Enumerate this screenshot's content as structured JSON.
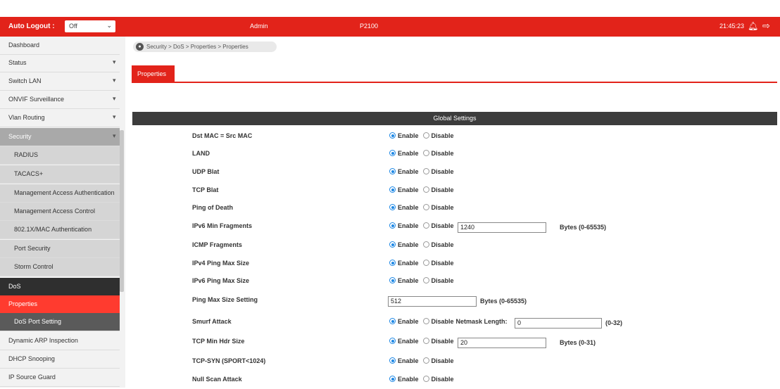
{
  "header": {
    "auto_logout_label": "Auto Logout :",
    "auto_logout_value": "Off",
    "user": "Admin",
    "model": "P2100",
    "time": "21:45:23"
  },
  "sidebar": {
    "items": [
      {
        "label": "Dashboard",
        "arrow": ""
      },
      {
        "label": "Status",
        "arrow": "▾"
      },
      {
        "label": "Switch LAN",
        "arrow": "▾"
      },
      {
        "label": "ONVIF Surveillance",
        "arrow": "▾"
      },
      {
        "label": "Vlan Routing",
        "arrow": "▾"
      },
      {
        "label": "Security",
        "arrow": "▾"
      },
      {
        "label": "RADIUS",
        "arrow": ""
      },
      {
        "label": "TACACS+",
        "arrow": ""
      },
      {
        "label": "Management Access Authentication",
        "arrow": ""
      },
      {
        "label": "Management Access Control",
        "arrow": ""
      },
      {
        "label": "802.1X/MAC Authentication",
        "arrow": ""
      },
      {
        "label": "Port Security",
        "arrow": ""
      },
      {
        "label": "Storm Control",
        "arrow": ""
      },
      {
        "label": "DoS",
        "arrow": ""
      },
      {
        "label": "Properties",
        "arrow": ""
      },
      {
        "label": "DoS Port Setting",
        "arrow": ""
      },
      {
        "label": "Dynamic ARP Inspection",
        "arrow": ""
      },
      {
        "label": "DHCP Snooping",
        "arrow": ""
      },
      {
        "label": "IP Source Guard",
        "arrow": ""
      }
    ]
  },
  "breadcrumb": "Security > DoS > Properties > Properties",
  "tab": "Properties",
  "section_title": "Global Settings",
  "labels": {
    "enable": "Enable",
    "disable": "Disable",
    "netmask": "Netmask Length:"
  },
  "settings": [
    {
      "name": "Dst MAC = Src MAC",
      "enabled": true
    },
    {
      "name": "LAND",
      "enabled": true
    },
    {
      "name": "UDP Blat",
      "enabled": true
    },
    {
      "name": "TCP Blat",
      "enabled": true
    },
    {
      "name": "Ping of Death",
      "enabled": true
    },
    {
      "name": "IPv6 Min Fragments",
      "enabled": true,
      "value": "1240",
      "unit": "Bytes (0-65535)"
    },
    {
      "name": "ICMP Fragments",
      "enabled": true
    },
    {
      "name": "IPv4 Ping Max Size",
      "enabled": true
    },
    {
      "name": "IPv6 Ping Max Size",
      "enabled": true
    },
    {
      "name": "Ping Max Size Setting",
      "value": "512",
      "unit": "Bytes (0-65535)"
    },
    {
      "name": "Smurf Attack",
      "enabled": true,
      "value": "0",
      "unit": "(0-32)"
    },
    {
      "name": "TCP Min Hdr Size",
      "enabled": true,
      "value": "20",
      "unit": "Bytes (0-31)"
    },
    {
      "name": "TCP-SYN (SPORT<1024)",
      "enabled": true
    },
    {
      "name": "Null Scan Attack",
      "enabled": true
    }
  ]
}
